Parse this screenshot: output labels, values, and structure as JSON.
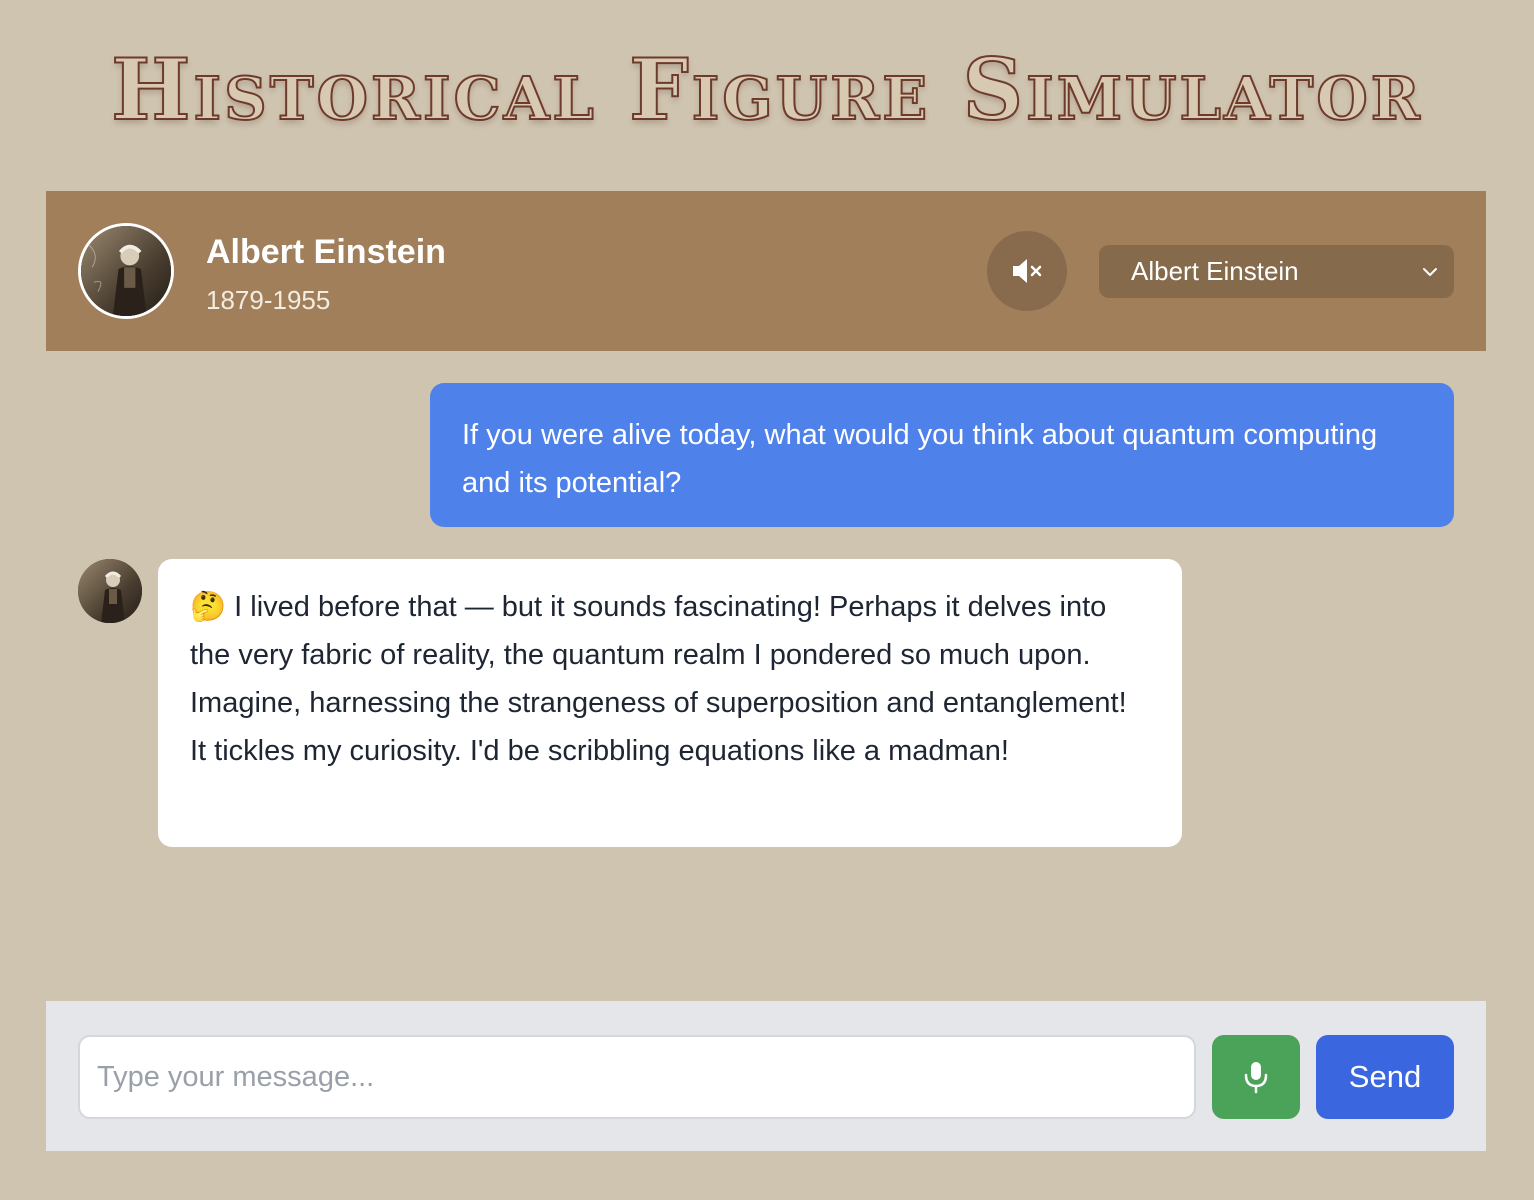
{
  "app": {
    "title": "Historical Figure Simulator"
  },
  "header": {
    "figure_name": "Albert Einstein",
    "figure_years": "1879-1955",
    "mute_icon": "speaker-muted-icon",
    "selected_figure": "Albert Einstein"
  },
  "messages": [
    {
      "role": "user",
      "text": "If you were alive today, what would you think about quantum computing and its potential?"
    },
    {
      "role": "assistant",
      "text": "🤔 I lived before that — but it sounds fascinating!  Perhaps it delves into the very fabric of reality, the quantum realm I pondered so much upon. Imagine, harnessing the strangeness of superposition and entanglement! It tickles my curiosity.  I'd be scribbling equations like a madman!"
    }
  ],
  "composer": {
    "placeholder": "Type your message...",
    "value": "",
    "mic_icon": "microphone-icon",
    "send_label": "Send"
  },
  "colors": {
    "background": "#cfc4b0",
    "header": "#a07f5a",
    "user_bubble": "#4f81ea",
    "mic_button": "#4ba35a",
    "send_button": "#3a66e0"
  }
}
